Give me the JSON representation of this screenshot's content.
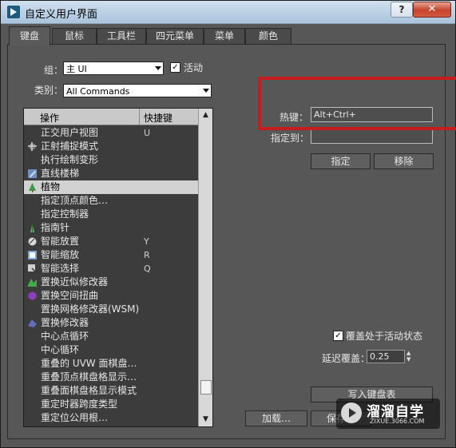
{
  "window": {
    "title": "自定义用户界面",
    "help_label": "?",
    "close_label": "✕"
  },
  "tabs": [
    {
      "label": "键盘",
      "active": true
    },
    {
      "label": "鼠标",
      "active": false
    },
    {
      "label": "工具栏",
      "active": false
    },
    {
      "label": "四元菜单",
      "active": false
    },
    {
      "label": "菜单",
      "active": false
    },
    {
      "label": "颜色",
      "active": false
    }
  ],
  "group": {
    "label": "组：",
    "value": "主 UI",
    "active_label": "活动",
    "active_checked": true
  },
  "category": {
    "label": "类别：",
    "value": "All Commands"
  },
  "list": {
    "col_action": "操作",
    "col_shortcut": "快捷键",
    "rows": [
      {
        "name": "正交用户视图",
        "key": "U",
        "icon": ""
      },
      {
        "name": "正射捕捉模式",
        "key": "",
        "icon": "snap-icon"
      },
      {
        "name": "执行绘制变形",
        "key": "",
        "icon": ""
      },
      {
        "name": "直线楼梯",
        "key": "",
        "icon": "stairs-icon"
      },
      {
        "name": "植物",
        "key": "",
        "icon": "plant-icon",
        "selected": true
      },
      {
        "name": "指定顶点颜色…",
        "key": "",
        "icon": ""
      },
      {
        "name": "指定控制器",
        "key": "",
        "icon": ""
      },
      {
        "name": "指南针",
        "key": "",
        "icon": "compass-icon"
      },
      {
        "name": "智能放置",
        "key": "Y",
        "icon": "smart-place-icon"
      },
      {
        "name": "智能缩放",
        "key": "R",
        "icon": "smart-scale-icon"
      },
      {
        "name": "智能选择",
        "key": "Q",
        "icon": "smart-select-icon"
      },
      {
        "name": "置换近似修改器",
        "key": "",
        "icon": "displace-approx-icon"
      },
      {
        "name": "置换空间扭曲",
        "key": "",
        "icon": "displace-space-icon"
      },
      {
        "name": "置换网格修改器(WSM)",
        "key": "",
        "icon": ""
      },
      {
        "name": "置换修改器",
        "key": "",
        "icon": "displace-mod-icon"
      },
      {
        "name": "中心点循环",
        "key": "",
        "icon": ""
      },
      {
        "name": "中心循环",
        "key": "",
        "icon": ""
      },
      {
        "name": "重叠的 UVW 面棋盘…",
        "key": "",
        "icon": ""
      },
      {
        "name": "重叠顶点棋盘格显示…",
        "key": "",
        "icon": ""
      },
      {
        "name": "重叠面棋盘格显示模式",
        "key": "",
        "icon": ""
      },
      {
        "name": "重定时器跨度类型",
        "key": "",
        "icon": ""
      },
      {
        "name": "重定位公用根…",
        "key": "",
        "icon": ""
      }
    ]
  },
  "hotkey": {
    "label": "热键：",
    "value": "Alt+Ctrl+"
  },
  "assigned_to": {
    "label": "指定到：",
    "value": ""
  },
  "buttons": {
    "assign": "指定",
    "remove": "移除",
    "write_keyboard": "写入键盘表",
    "load": "加载…",
    "save": "保存…"
  },
  "override": {
    "label": "覆盖处于活动状态",
    "checked": true
  },
  "delay": {
    "label": "延迟覆盖：",
    "value": "0.25"
  },
  "watermark": {
    "title": "溜溜自学",
    "url": "ZIXUE.3066.COM"
  },
  "colors": {
    "highlight_box": "#c51d1d",
    "selection_row": "#d2d2d2",
    "list_bg": "#3c3c3c"
  }
}
